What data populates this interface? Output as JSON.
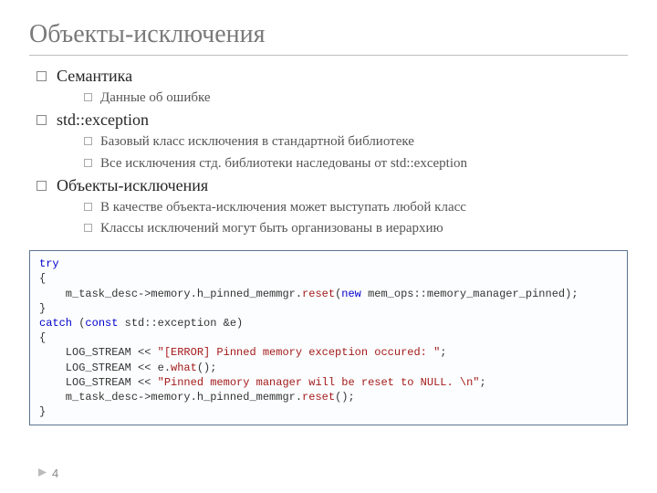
{
  "title": "Объекты-исключения",
  "bullets": [
    {
      "text": "Семантика",
      "sub": [
        "Данные об ошибке"
      ]
    },
    {
      "text": "std::exception",
      "sub": [
        "Базовый класс исключения в стандартной библиотеке",
        "Все исключения стд. библиотеки наследованы от std::exception"
      ]
    },
    {
      "text": "Объекты-исключения",
      "sub": [
        "В качестве объекта-исключения может выступать любой класс",
        "Классы исключений могут быть организованы в иерархию"
      ]
    }
  ],
  "code": {
    "l1": "try",
    "l2": "{",
    "l3a": "    m_task_desc->memory.h_pinned_memmgr.",
    "l3b": "reset",
    "l3c": "(",
    "l3d": "new",
    "l3e": " mem_ops::memory_manager_pinned);",
    "l4": "}",
    "l5a": "catch",
    "l5b": " (",
    "l5c": "const",
    "l5d": " std::exception &e)",
    "l6": "{",
    "l7a": "    LOG_STREAM << ",
    "l7b": "\"[ERROR] Pinned memory exception occured: \"",
    "l7c": ";",
    "l8a": "    LOG_STREAM << e.",
    "l8b": "what",
    "l8c": "();",
    "l9a": "    LOG_STREAM << ",
    "l9b": "\"Pinned memory manager will be reset to NULL. \\n\"",
    "l9c": ";",
    "l10a": "    m_task_desc->memory.h_pinned_memmgr.",
    "l10b": "reset",
    "l10c": "();",
    "l11": "}"
  },
  "pagenum": "4"
}
